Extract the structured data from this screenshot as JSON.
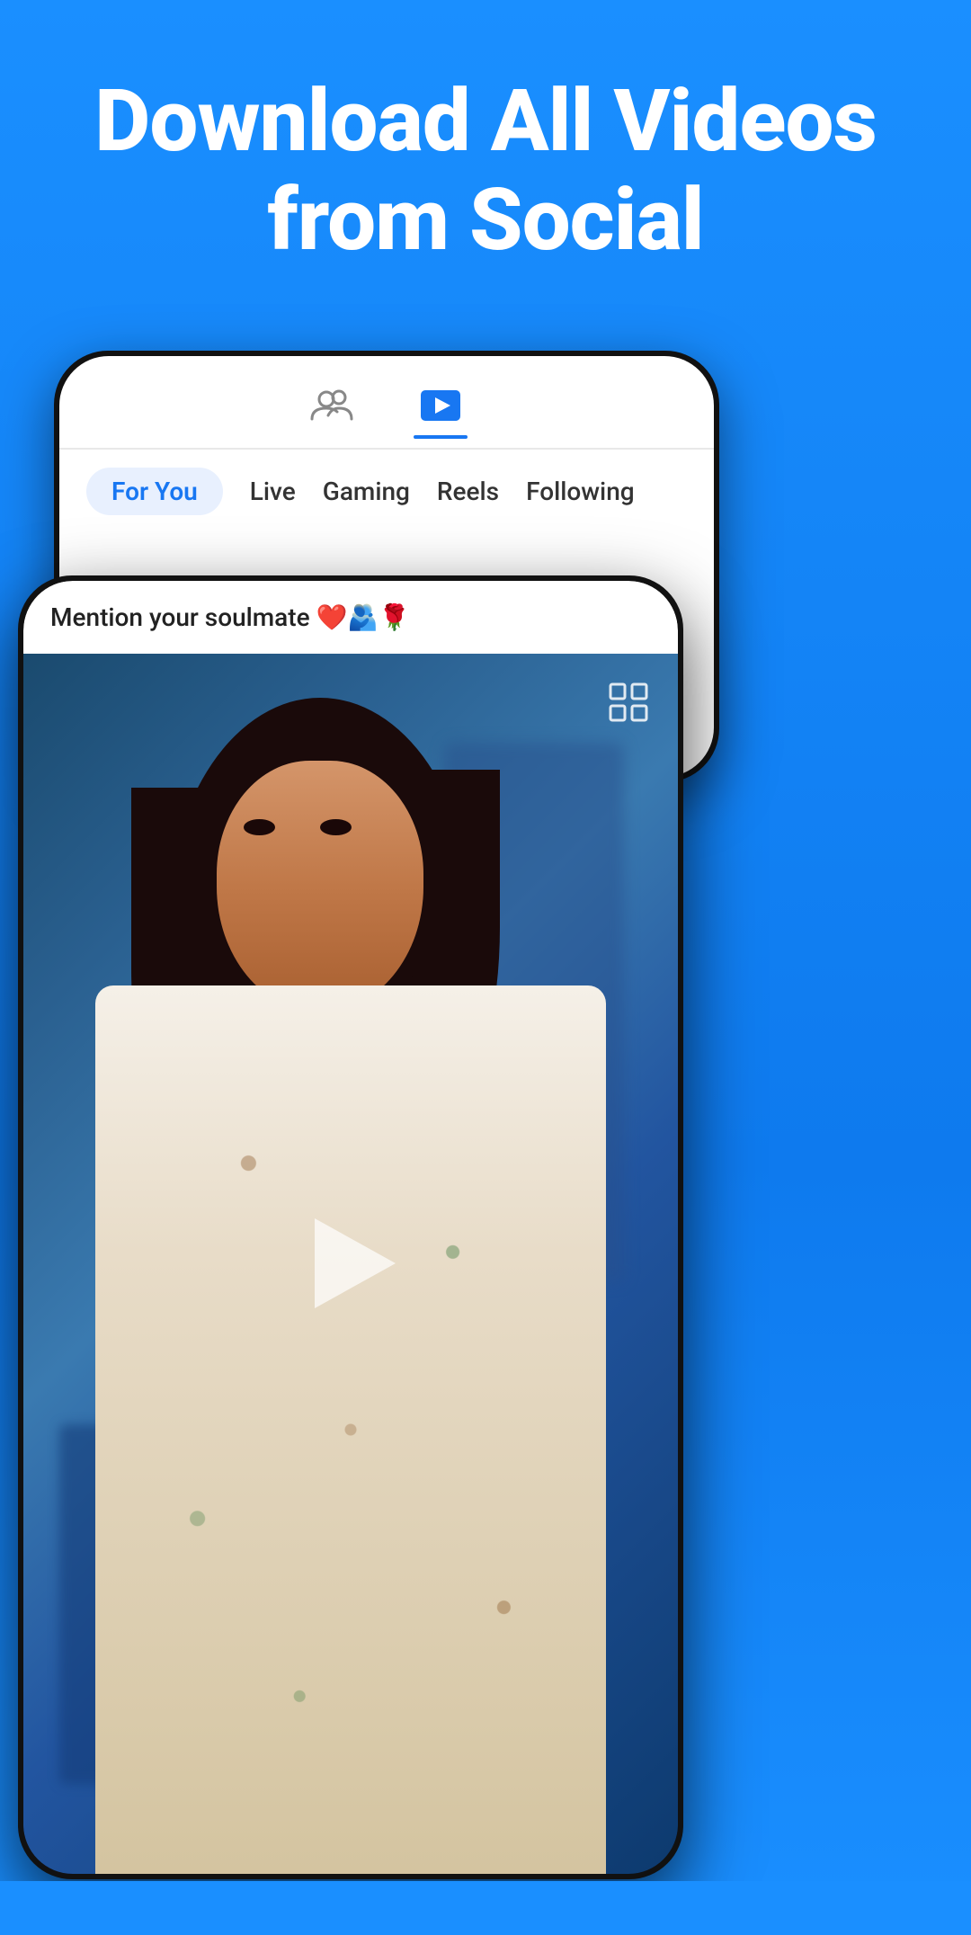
{
  "hero": {
    "title_line1": "Download All Videos",
    "title_line2": "from Social"
  },
  "phone_back": {
    "tab1_icon": "people-icon",
    "tab2_icon": "video-play-icon",
    "nav_items": [
      {
        "label": "For You",
        "active": true
      },
      {
        "label": "Live",
        "active": false
      },
      {
        "label": "Gaming",
        "active": false
      },
      {
        "label": "Reels",
        "active": false
      },
      {
        "label": "Following",
        "active": false
      }
    ]
  },
  "phone_front": {
    "caption": "Mention your soulmate ❤️🫂🌹",
    "expand_icon": "expand-icon"
  },
  "colors": {
    "background": "#1a8fff",
    "accent": "#1877f2",
    "white": "#ffffff"
  }
}
